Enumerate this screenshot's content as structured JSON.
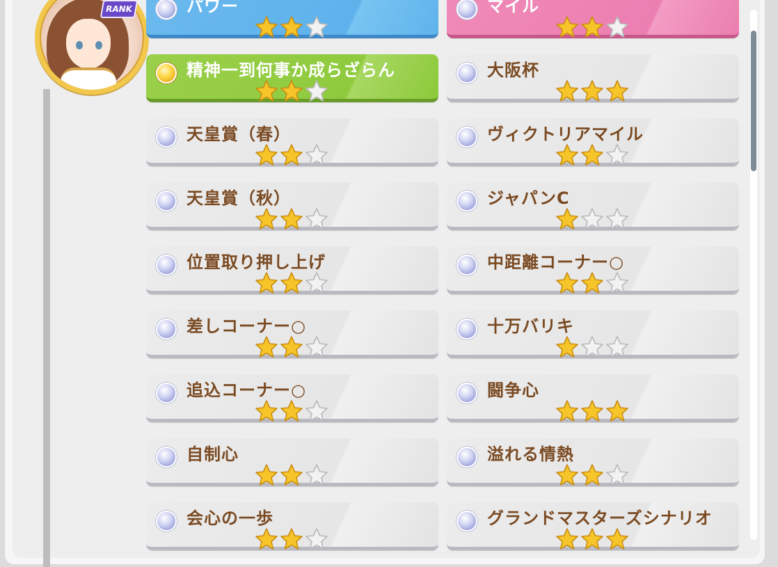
{
  "rank_badge": "RANK",
  "skills_left": [
    {
      "label": "パワー",
      "stars": 2,
      "style": "blue",
      "dot": "silver"
    },
    {
      "label": "精神一到何事か成らざらん",
      "stars": 2,
      "style": "green",
      "dot": "gold"
    },
    {
      "label": "天皇賞（春）",
      "stars": 2,
      "style": "gray",
      "dot": "silver"
    },
    {
      "label": "天皇賞（秋）",
      "stars": 2,
      "style": "gray",
      "dot": "silver"
    },
    {
      "label": "位置取り押し上げ",
      "stars": 2,
      "style": "gray",
      "dot": "silver"
    },
    {
      "label": "差しコーナー○",
      "stars": 2,
      "style": "gray",
      "dot": "silver"
    },
    {
      "label": "追込コーナー○",
      "stars": 2,
      "style": "gray",
      "dot": "silver"
    },
    {
      "label": "自制心",
      "stars": 2,
      "style": "gray",
      "dot": "silver"
    },
    {
      "label": "会心の一歩",
      "stars": 2,
      "style": "gray",
      "dot": "silver"
    }
  ],
  "skills_right": [
    {
      "label": "マイル",
      "stars": 2,
      "style": "pink",
      "dot": "silver"
    },
    {
      "label": "大阪杯",
      "stars": 3,
      "style": "gray",
      "dot": "silver"
    },
    {
      "label": "ヴィクトリアマイル",
      "stars": 2,
      "style": "gray",
      "dot": "silver"
    },
    {
      "label": "ジャパンC",
      "stars": 1,
      "style": "gray",
      "dot": "silver"
    },
    {
      "label": "中距離コーナー○",
      "stars": 2,
      "style": "gray",
      "dot": "silver"
    },
    {
      "label": "十万バリキ",
      "stars": 1,
      "style": "gray",
      "dot": "silver"
    },
    {
      "label": "闘争心",
      "stars": 3,
      "style": "gray",
      "dot": "silver"
    },
    {
      "label": "溢れる情熱",
      "stars": 2,
      "style": "gray",
      "dot": "silver"
    },
    {
      "label": "グランドマスターズシナリオ",
      "stars": 3,
      "style": "gray",
      "dot": "silver"
    }
  ],
  "max_stars": 3,
  "colors": {
    "star_filled": "#f6c52a",
    "star_empty": "#f2f2f2",
    "label_text": "#7a4a22"
  }
}
